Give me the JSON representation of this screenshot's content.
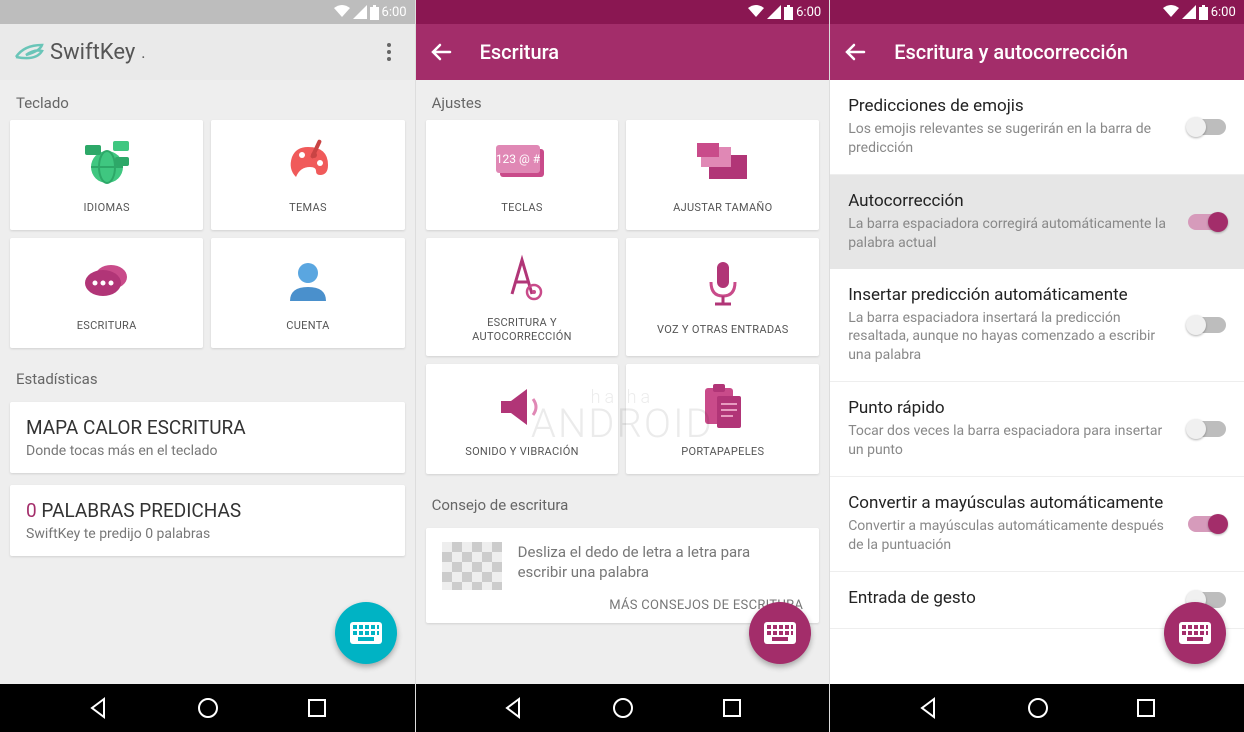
{
  "status": {
    "time": "6:00"
  },
  "screen1": {
    "app_name": "SwiftKey",
    "section_keyboard": "Teclado",
    "section_stats": "Estadísticas",
    "cards": {
      "idiomas": "IDIOMAS",
      "temas": "TEMAS",
      "escritura": "ESCRITURA",
      "cuenta": "CUENTA"
    },
    "heatmap": {
      "title": "MAPA CALOR ESCRITURA",
      "sub": "Donde tocas más en el teclado"
    },
    "predicted": {
      "count": "0",
      "title": "PALABRAS PREDICHAS",
      "sub": "SwiftKey te predijo 0 palabras"
    }
  },
  "screen2": {
    "title": "Escritura",
    "section_settings": "Ajustes",
    "section_tip": "Consejo de escritura",
    "cards": {
      "teclas": "TECLAS",
      "tamano": "AJUSTAR TAMAÑO",
      "auto": "ESCRITURA Y\nAUTOCORRECCIÓN",
      "voz": "VOZ Y OTRAS ENTRADAS",
      "sonido": "SONIDO Y VIBRACIÓN",
      "porta": "PORTAPAPELES"
    },
    "tip_text": "Desliza el dedo de letra a letra para escribir una palabra",
    "tip_more": "MÁS CONSEJOS DE ESCRITURA"
  },
  "screen3": {
    "title": "Escritura y autocorrección",
    "rows": [
      {
        "title": "Predicciones de emojis",
        "desc": "Los emojis relevantes se sugerirán en la barra de predicción",
        "on": false
      },
      {
        "title": "Autocorrección",
        "desc": "La barra espaciadora corregirá automáticamente la palabra actual",
        "on": true,
        "selected": true
      },
      {
        "title": "Insertar predicción automáticamente",
        "desc": "La barra espaciadora insertará la predicción resaltada, aunque no hayas comenzado a escribir una palabra",
        "on": false
      },
      {
        "title": "Punto rápido",
        "desc": "Tocar dos veces la barra espaciadora para insertar un punto",
        "on": false
      },
      {
        "title": "Convertir a mayúsculas automáticamente",
        "desc": "Convertir a mayúsculas automáticamente después de la puntuación",
        "on": true
      },
      {
        "title": "Entrada de gesto",
        "desc": "",
        "on": false
      }
    ]
  },
  "watermark": {
    "top": "ha ha",
    "bottom": "ANDROID"
  }
}
